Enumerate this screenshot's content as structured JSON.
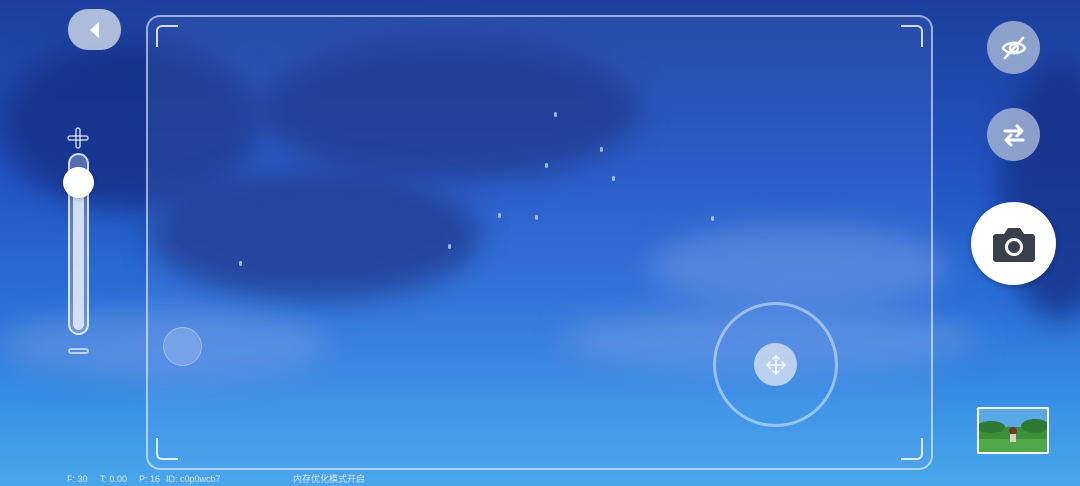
{
  "debug": {
    "fps": "F: 30",
    "time": "T: 0.00",
    "players": "P: 16",
    "id": "ID: c0p0wcb7",
    "mode_notice": "内存优化模式开启"
  },
  "controls": {
    "back": {
      "icon": "chevron-left-icon"
    },
    "zoom": {
      "plus_icon": "plus-icon",
      "minus_icon": "minus-icon",
      "level": 0.85
    },
    "hide_ui": {
      "icon": "eye-off-icon"
    },
    "switch_camera": {
      "icon": "switch-arrows-icon"
    },
    "shutter": {
      "icon": "camera-icon"
    },
    "joystick": {
      "icon": "move-arrows-icon"
    }
  },
  "colors": {
    "sky_top": "#1c3f9b",
    "sky_bottom": "#4aa6ea",
    "button_gray": "#aab9d7",
    "icon_dark": "#3a3f4c"
  }
}
